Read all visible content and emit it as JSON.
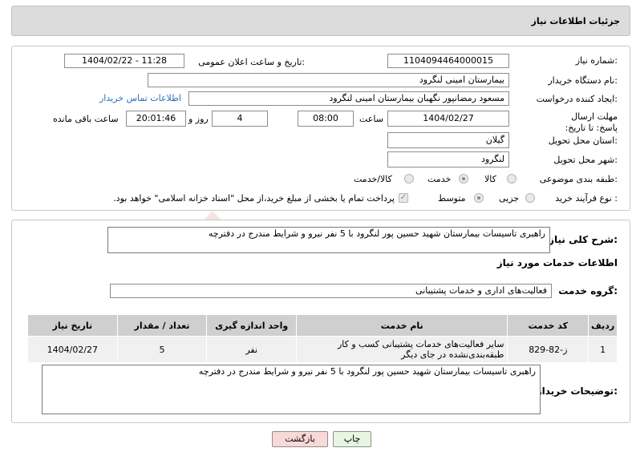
{
  "header": {
    "title": "جزئیات اطلاعات نیاز"
  },
  "form": {
    "need_number_label": "شماره نیاز:",
    "need_number": "1104094464000015",
    "announce_label": "تاریخ و ساعت اعلان عمومی:",
    "announce_value": "1404/02/22 - 11:28",
    "buyer_label": "نام دستگاه خریدار:",
    "buyer_value": "بیمارستان امینی لنگرود",
    "creator_label": "ایجاد کننده درخواست:",
    "creator_value": "مسعود رمضانپور نگهبان بیمارستان امینی لنگرود",
    "contact_link": "اطلاعات تماس خریدار",
    "deadline_label": "مهلت ارسال پاسخ: تا تاریخ:",
    "deadline_date": "1404/02/27",
    "time_label": "ساعت",
    "deadline_time": "08:00",
    "days_value": "4",
    "days_label": "روز و",
    "remaining_time": "20:01:46",
    "remaining_label": "ساعت باقی مانده",
    "province_label": "استان محل تحویل:",
    "province_value": "گیلان",
    "city_label": "شهر محل تحویل:",
    "city_value": "لنگرود",
    "category_label": "طبقه بندی موضوعی:",
    "category_options": [
      "کالا",
      "خدمت",
      "کالا/خدمت"
    ],
    "purchase_label": "نوع فرآیند خرید :",
    "purchase_options": [
      "جزیی",
      "متوسط"
    ],
    "payment_note": "پرداخت تمام یا بخشی از مبلغ خرید،از محل \"اسناد خزانه اسلامی\" خواهد بود."
  },
  "general": {
    "desc_label": "شرح کلی نیاز:",
    "desc_value": "راهبری تاسیسات بیمارستان شهید حسین پور لنگرود با 5 نفر نیرو و شرایط مندرج در دفترچه",
    "services_title": "اطلاعات خدمات مورد نیاز",
    "group_label": "گروه خدمت:",
    "group_value": "فعالیت‌های اداری و خدمات پشتیبانی"
  },
  "table": {
    "headers": [
      "ردیف",
      "کد خدمت",
      "نام خدمت",
      "واحد اندازه گیری",
      "تعداد / مقدار",
      "تاریخ نیاز"
    ],
    "rows": [
      [
        "1",
        "ز-82-829",
        "سایر فعالیت‌های خدمات پشتیبانی کسب و کار طبقه‌بندی‌نشده در جای دیگر",
        "نفر",
        "5",
        "1404/02/27"
      ]
    ]
  },
  "buyer_notes": {
    "label": "توضیحات خریدار:",
    "value": "راهبری تاسیسات بیمارستان شهید حسین پور لنگرود با 5 نفر نیرو و شرایط مندرج در دفترچه"
  },
  "buttons": {
    "print": "چاپ",
    "back": "بازگشت"
  },
  "watermark": "AriaTender.neT",
  "colors": {
    "header_bg": "#dcdcdc",
    "link": "#2a6ebb",
    "back_button": "#f9d8d8",
    "print_button": "#e8f5e0"
  }
}
